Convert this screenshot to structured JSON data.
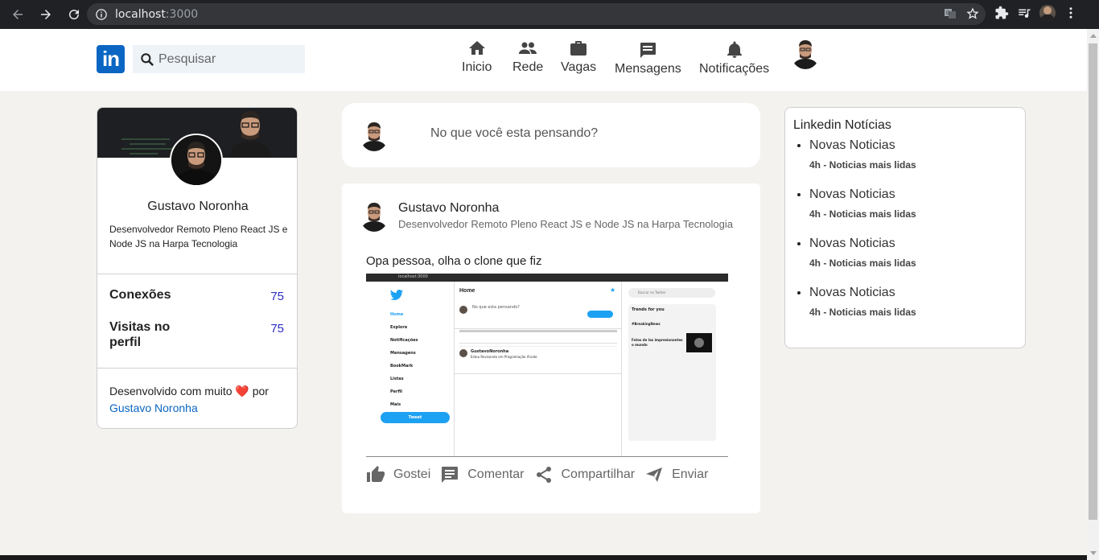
{
  "browser": {
    "url_host": "localhost",
    "url_port": ":3000"
  },
  "header": {
    "logo_text": "in",
    "search_placeholder": "Pesquisar",
    "nav": [
      {
        "label": "Inicio",
        "icon": "home-icon"
      },
      {
        "label": "Rede",
        "icon": "people-icon"
      },
      {
        "label": "Vagas",
        "icon": "briefcase-icon"
      },
      {
        "label": "Mensagens",
        "icon": "chat-icon"
      },
      {
        "label": "Notificações",
        "icon": "bell-icon"
      }
    ]
  },
  "profile": {
    "name": "Gustavo Noronha",
    "headline": "Desenvolvedor Remoto Pleno React JS e Node JS na Harpa Tecnologia",
    "stats": [
      {
        "label": "Conexões",
        "value": "75"
      },
      {
        "label": "Visitas no perfil",
        "value": "75"
      }
    ],
    "footer_prefix": "Desenvolvido com muito",
    "footer_heart": "❤️",
    "footer_by": "por",
    "footer_link": "Gustavo Noronha"
  },
  "composer": {
    "placeholder": "No que você esta pensando?"
  },
  "post": {
    "author": "Gustavo Noronha",
    "headline": "Desenvolvedor Remoto Pleno React JS e Node JS na Harpa Tecnologia",
    "text": "Opa pessoa, olha o clone que fiz",
    "actions": [
      {
        "label": "Gostei",
        "icon": "thumbs-up-icon"
      },
      {
        "label": "Comentar",
        "icon": "comment-icon"
      },
      {
        "label": "Compartilhar",
        "icon": "share-icon"
      },
      {
        "label": "Enviar",
        "icon": "send-icon"
      }
    ],
    "screenshot": {
      "url": "localhost:3000",
      "home": "Home",
      "sidebar": [
        "Home",
        "Explore",
        "Notificações",
        "Mensagens",
        "BookMark",
        "Listas",
        "Perfil",
        "Mais"
      ],
      "tweet_button": "Tweet",
      "compose_placeholder": "No que esta pensando?",
      "post_author": "GustavoNoronha",
      "post_text": "Estou Revisando em Programação #code",
      "search_placeholder": "Buscar no Twitter",
      "trends_title": "Trends for you",
      "trend_tag": "#BreakingNews",
      "trend_story": "Fotos de las impresionantes o mundo"
    }
  },
  "news": {
    "title": "Linkedin Notícias",
    "items": [
      {
        "title": "Novas Noticias",
        "sub": "4h - Noticias mais lidas"
      },
      {
        "title": "Novas Noticias",
        "sub": "4h - Noticias mais lidas"
      },
      {
        "title": "Novas Noticias",
        "sub": "4h - Noticias mais lidas"
      },
      {
        "title": "Novas Noticias",
        "sub": "4h - Noticias mais lidas"
      }
    ]
  }
}
